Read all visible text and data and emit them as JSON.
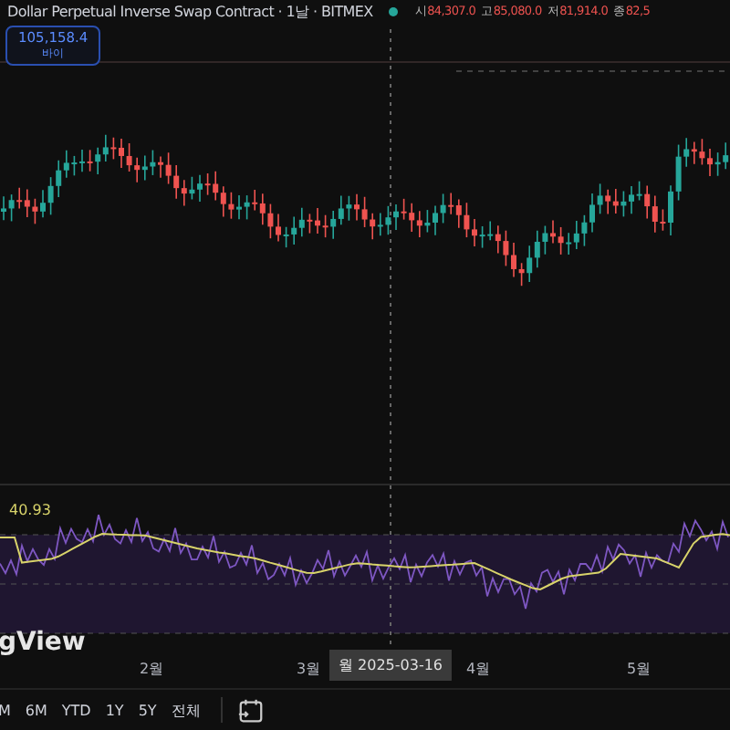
{
  "header": {
    "title": "Dollar Perpetual Inverse Swap Contract · 1날 · BITMEX",
    "ohlc": [
      {
        "label": "시",
        "value": "84,307.0"
      },
      {
        "label": "고",
        "value": "85,080.0"
      },
      {
        "label": "저",
        "value": "81,914.0"
      },
      {
        "label": "종",
        "value": "82,5"
      }
    ]
  },
  "buy_badge": {
    "price": "105,158.4",
    "label": "바이"
  },
  "logo_text": "gView",
  "rsi": {
    "value": "40.93"
  },
  "time_axis": {
    "labels": [
      "2월",
      "3월",
      "4월",
      "5월"
    ],
    "crosshair_label": "월 2025-03-16"
  },
  "ranges": [
    "M",
    "6M",
    "YTD",
    "1Y",
    "5Y",
    "전체"
  ]
}
